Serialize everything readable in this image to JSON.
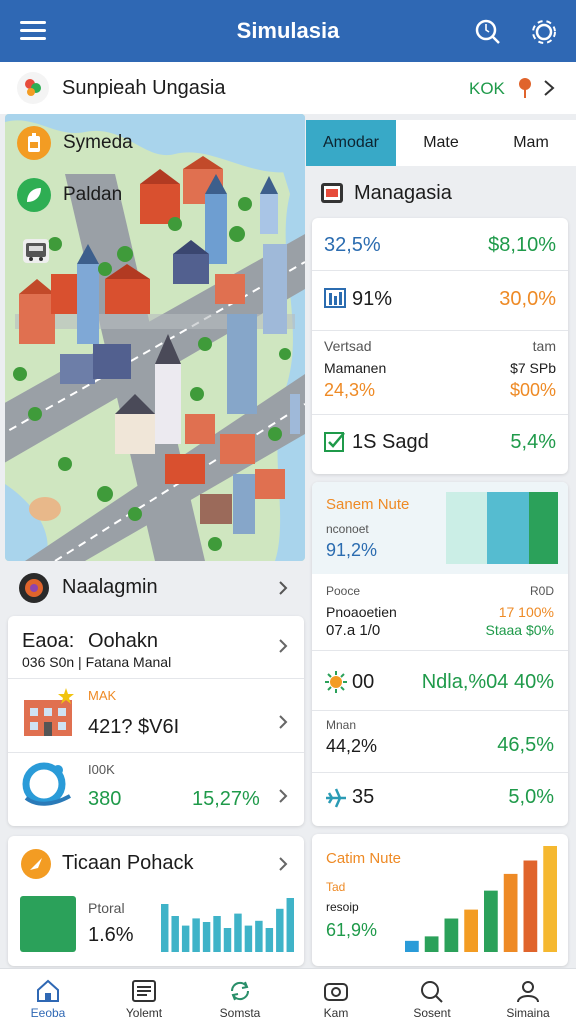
{
  "header": {
    "title": "Simulasia",
    "menu_icon": "menu-icon",
    "search_icon": "search-icon",
    "settings_icon": "gear-icon"
  },
  "subbar": {
    "name": "Sunpieah Ungasia",
    "code": "KOK"
  },
  "map": {
    "chips": [
      {
        "label": "Symeda",
        "icon": "battery-icon",
        "color": "#f39c23"
      },
      {
        "label": "Paldan",
        "icon": "leaf-icon",
        "color": "#2eae53"
      }
    ]
  },
  "tabs": [
    {
      "label": "Amodar",
      "active": true
    },
    {
      "label": "Mate",
      "active": false
    },
    {
      "label": "Mam",
      "active": false
    }
  ],
  "management": {
    "title": "Managasia"
  },
  "stats_card": {
    "r1": {
      "left": "32,5%",
      "right": "$8,10%"
    },
    "r2": {
      "left": "91%",
      "right": "30,0%"
    },
    "r3": {
      "label_a": "Vertsad",
      "label_b": "Mamanen",
      "value_left": "24,3%",
      "right_a": "tam",
      "right_b": "$7 SPb",
      "right_c": "$00%"
    },
    "r4": {
      "left": "1S Sagd",
      "right": "5,4%"
    }
  },
  "feature": {
    "title": "Sanem Nute",
    "sub": "nconoet",
    "value": "91,2%",
    "colors": [
      "#cbeee6",
      "#55bcd0",
      "#2ba15a"
    ]
  },
  "stats2": {
    "r1": {
      "a": "Pooce",
      "b": "Pnoaoetien",
      "c": "07.a 1/0",
      "ra": "R0D",
      "rb": "17 100%",
      "rc": "Staaa $0%"
    },
    "r2": {
      "left": "00",
      "right": "Ndla,%04 40%"
    },
    "r3": {
      "a": "Mnan",
      "b": "44,2%",
      "right": "46,5%"
    },
    "r4": {
      "left": "35",
      "right": "5,0%"
    }
  },
  "naalagmin": {
    "title": "Naalagmin"
  },
  "left_card": {
    "r1": {
      "label": "Eaoa:",
      "title": "Oohakn",
      "sub": "036 S0n | Fatana Manal"
    },
    "r2": {
      "tag": "MAK",
      "value": "421? $V6I"
    },
    "r3": {
      "tag": "I00K",
      "value": "380",
      "right": "15,27%"
    }
  },
  "promo": {
    "title": "Ticaan Pohack",
    "sub": "Ptoral",
    "value": "1.6%",
    "bars": [
      40,
      30,
      22,
      28,
      25,
      30,
      20,
      32,
      22,
      26,
      20,
      36,
      45
    ]
  },
  "bottom_chart": {
    "title": "Catim Nute",
    "sub1": "Tad",
    "sub2": "resoip",
    "value": "61,9%",
    "bars": [
      10,
      14,
      30,
      38,
      55,
      70,
      82,
      95
    ]
  },
  "bottom_nav": [
    {
      "label": "Eeoba",
      "icon": "home-icon",
      "active": true
    },
    {
      "label": "Yolemt",
      "icon": "list-icon",
      "active": false
    },
    {
      "label": "Somsta",
      "icon": "sync-icon",
      "active": false
    },
    {
      "label": "Kam",
      "icon": "camera-icon",
      "active": false
    },
    {
      "label": "Sosent",
      "icon": "search-icon",
      "active": false
    },
    {
      "label": "Simaina",
      "icon": "profile-icon",
      "active": false
    }
  ]
}
